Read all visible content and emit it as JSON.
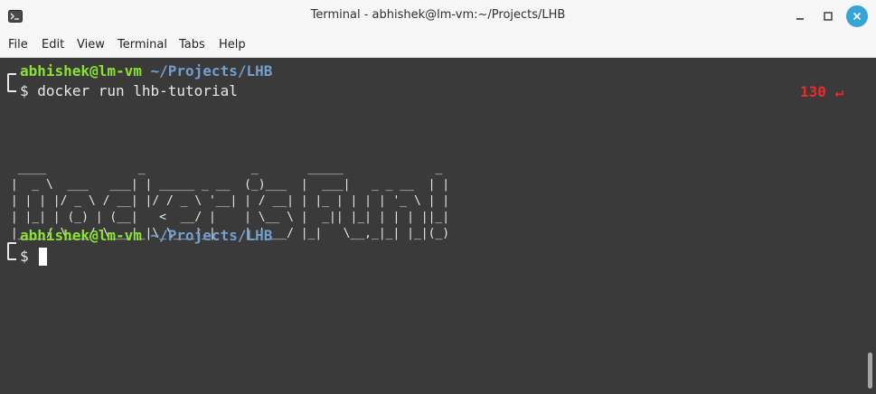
{
  "window": {
    "title": "Terminal - abhishek@lm-vm:~/Projects/LHB",
    "accent": "#35a4d6"
  },
  "menubar": {
    "items": [
      "File",
      "Edit",
      "View",
      "Terminal",
      "Tabs",
      "Help"
    ]
  },
  "terminal": {
    "background": "#3a3a3a",
    "prompts": [
      {
        "user": "abhishek@lm-vm",
        "path": "~/Projects/LHB",
        "symbol": "$",
        "command": "docker run lhb-tutorial"
      },
      {
        "user": "abhishek@lm-vm",
        "path": "~/Projects/LHB",
        "symbol": "$",
        "command": ""
      }
    ],
    "exit_status": "130 ↵",
    "output_ascii": [
      "  ____             _               _       _____             _ ",
      " |  _ \\  ___   ___| | _____ _ __  (_)___  |  ___|   _ _ __  | |",
      " | | | |/ _ \\ / __| |/ / _ \\ '__| | / __| | |_ | | | | '_ \\ | |",
      " | |_| | (_) | (__|   <  __/ |    | \\__ \\ |  _|| |_| | | | ||_|",
      " |____/ \\___/ \\___|_|\\_\\___|_|    |_|___/ |_|   \\__,_|_| |_|(_)"
    ]
  }
}
